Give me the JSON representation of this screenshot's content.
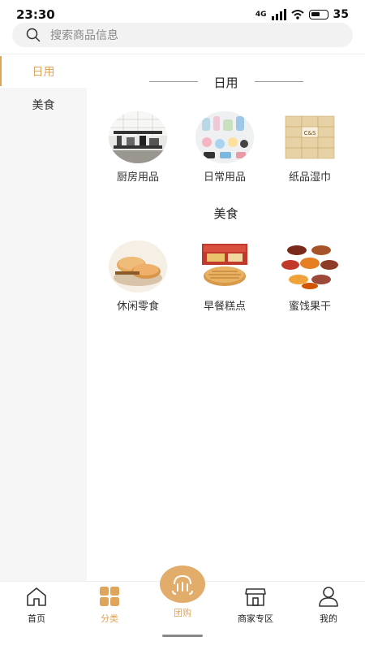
{
  "status": {
    "time": "23:30",
    "battery": "35",
    "network": "4G"
  },
  "search": {
    "placeholder": "搜索商品信息"
  },
  "sidebar": {
    "items": [
      {
        "label": "日用",
        "active": true
      },
      {
        "label": "美食",
        "active": false
      }
    ]
  },
  "sections": [
    {
      "title": "日用",
      "items": [
        {
          "label": "厨房用品"
        },
        {
          "label": "日常用品"
        },
        {
          "label": "纸品湿巾"
        }
      ]
    },
    {
      "title": "美食",
      "items": [
        {
          "label": "休闲零食"
        },
        {
          "label": "早餐糕点"
        },
        {
          "label": "蜜饯果干"
        }
      ]
    }
  ],
  "tabbar": {
    "items": [
      {
        "label": "首页"
      },
      {
        "label": "分类"
      },
      {
        "label": "团购"
      },
      {
        "label": "商家专区"
      },
      {
        "label": "我的"
      }
    ],
    "active": "分类"
  },
  "colors": {
    "accent": "#e0a55d",
    "sidebar_bg": "#f6f6f6",
    "search_bg": "#f2f2f2"
  }
}
